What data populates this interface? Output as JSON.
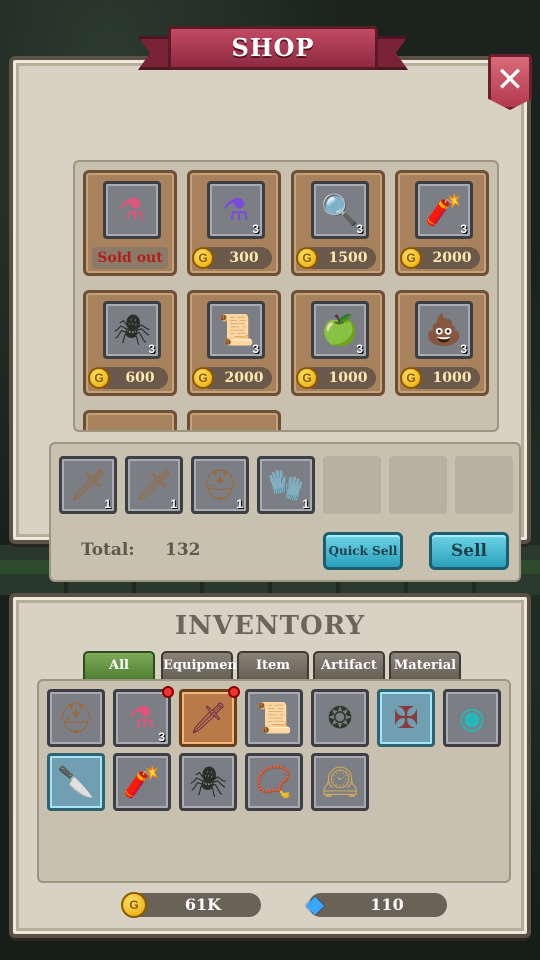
{
  "shop": {
    "title": "SHOP",
    "close_glyph": "✕",
    "items": [
      {
        "icon": "pink-potion-icon",
        "glyph": "⚗",
        "color": "#e0547a",
        "qty": "",
        "status": "Sold out",
        "price": ""
      },
      {
        "icon": "purple-potion-icon",
        "glyph": "⚗",
        "color": "#7a4be0",
        "qty": "3",
        "status": "",
        "price": "300"
      },
      {
        "icon": "magnifying-glass-icon",
        "glyph": "🔍",
        "color": "#333333",
        "qty": "3",
        "status": "",
        "price": "1500"
      },
      {
        "icon": "dynamite-icon",
        "glyph": "🧨",
        "color": "#a9302a",
        "qty": "3",
        "status": "",
        "price": "2000"
      },
      {
        "icon": "spider-drone-icon",
        "glyph": "🕷",
        "color": "#2b2f2a",
        "qty": "3",
        "status": "",
        "price": "600"
      },
      {
        "icon": "wanted-poster-icon",
        "glyph": "📜",
        "color": "#c9b48a",
        "qty": "3",
        "status": "",
        "price": "2000"
      },
      {
        "icon": "glowing-apple-icon",
        "glyph": "🍏",
        "color": "#bfe9ff",
        "qty": "3",
        "status": "",
        "price": "1000"
      },
      {
        "icon": "slime-pile-icon",
        "glyph": "💩",
        "color": "#b9b33a",
        "qty": "3",
        "status": "",
        "price": "1000"
      }
    ],
    "sell_slots": [
      {
        "icon": "dagger-icon",
        "glyph": "🗡",
        "qty": "1"
      },
      {
        "icon": "dagger-icon",
        "glyph": "🗡",
        "qty": "1"
      },
      {
        "icon": "helmet-icon",
        "glyph": "⛑",
        "qty": "1"
      },
      {
        "icon": "claw-gauntlet-icon",
        "glyph": "🧤",
        "qty": "1"
      },
      {
        "icon": "",
        "glyph": "",
        "qty": ""
      },
      {
        "icon": "",
        "glyph": "",
        "qty": ""
      },
      {
        "icon": "",
        "glyph": "",
        "qty": ""
      }
    ],
    "total_label": "Total:",
    "total_value": "132",
    "quick_sell_label": "Quick Sell",
    "sell_label": "Sell"
  },
  "inventory": {
    "title": "INVENTORY",
    "tabs": [
      "All",
      "Equipment",
      "Item",
      "Artifact",
      "Material"
    ],
    "active_tab": "All",
    "items": [
      {
        "icon": "helmet-icon",
        "glyph": "⛑",
        "color": "#9a6a3a",
        "qty": "",
        "rarity": "common",
        "new": false
      },
      {
        "icon": "pink-potion-icon",
        "glyph": "⚗",
        "color": "#e0547a",
        "qty": "3",
        "rarity": "common",
        "new": true
      },
      {
        "icon": "curved-blade-icon",
        "glyph": "🗡",
        "color": "#6a2a4a",
        "qty": "",
        "rarity": "epic",
        "new": true
      },
      {
        "icon": "wanted-poster-icon",
        "glyph": "📜",
        "color": "#c9b48a",
        "qty": "",
        "rarity": "common",
        "new": false
      },
      {
        "icon": "thorn-ring-icon",
        "glyph": "❂",
        "color": "#2d3a2a",
        "qty": "",
        "rarity": "common",
        "new": false
      },
      {
        "icon": "spiked-staff-icon",
        "glyph": "✠",
        "color": "#8a3a3a",
        "qty": "",
        "rarity": "rare",
        "new": false
      },
      {
        "icon": "teal-amulet-icon",
        "glyph": "◉",
        "color": "#27b6b6",
        "qty": "",
        "rarity": "common",
        "new": false
      },
      {
        "icon": "cleaver-icon",
        "glyph": "🔪",
        "color": "#cfd6da",
        "qty": "",
        "rarity": "rare",
        "new": false
      },
      {
        "icon": "dynamite-icon",
        "glyph": "🧨",
        "color": "#a9302a",
        "qty": "",
        "rarity": "common",
        "new": false
      },
      {
        "icon": "spider-drone-icon",
        "glyph": "🕷",
        "color": "#2b2f2a",
        "qty": "",
        "rarity": "common",
        "new": false
      },
      {
        "icon": "green-gem-necklace-icon",
        "glyph": "📿",
        "color": "#3a8a3a",
        "qty": "",
        "rarity": "common",
        "new": false
      },
      {
        "icon": "clock-scroll-icon",
        "glyph": "🕰",
        "color": "#c9a85a",
        "qty": "",
        "rarity": "common",
        "new": false
      }
    ]
  },
  "currency": {
    "gold_value": "61K",
    "gem_value": "110",
    "coin_glyph": "G",
    "gem_glyph": "◆",
    "gold_color": "#e8a400",
    "gem_color": "#3aa7ff"
  }
}
